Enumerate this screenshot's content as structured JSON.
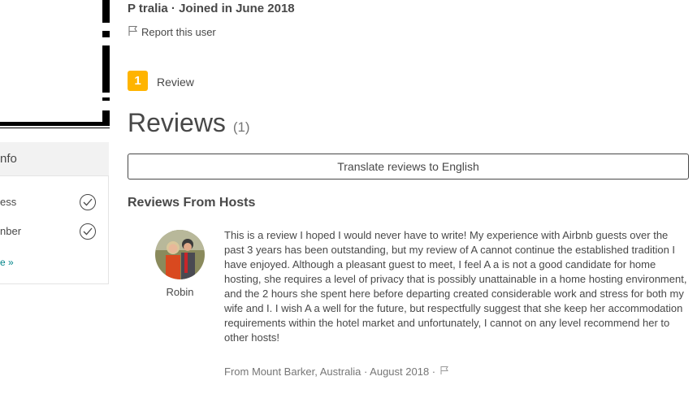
{
  "profile": {
    "owner_line": "P            tralia · Joined in June 2018",
    "report_label": "Report this user"
  },
  "sidebar": {
    "info_title": "nfo",
    "verifications": [
      {
        "label": "ess"
      },
      {
        "label": "nber"
      }
    ],
    "learn_more": "e »"
  },
  "badges": {
    "review_count": "1",
    "review_label": "Review"
  },
  "reviews": {
    "title": "Reviews",
    "count": "(1)",
    "translate_button": "Translate reviews to English",
    "section_title": "Reviews From Hosts",
    "items": [
      {
        "reviewer": "Robin",
        "text": "This is a review I hoped I would never have to write! My experience with Airbnb guests over the past 3 years has been outstanding, but my review of A     cannot continue the established tradition I have enjoyed. Although a pleasant guest to meet, I feel A     a is not a good candidate for home hosting, she requires a level of privacy that is possibly unattainable in a home hosting environment, and the 2 hours she spent here before departing created considerable work and stress for both my wife and I. I wish A      a well for the future, but respectfully suggest that she keep her accommodation requirements within the hotel market and unfortunately, I cannot on any level recommend her to other hosts!",
        "meta": "From Mount Barker, Australia · August 2018 ·"
      }
    ]
  },
  "colors": {
    "text": "#484848",
    "muted": "#767676",
    "badge": "#ffb400",
    "link": "#008489"
  }
}
